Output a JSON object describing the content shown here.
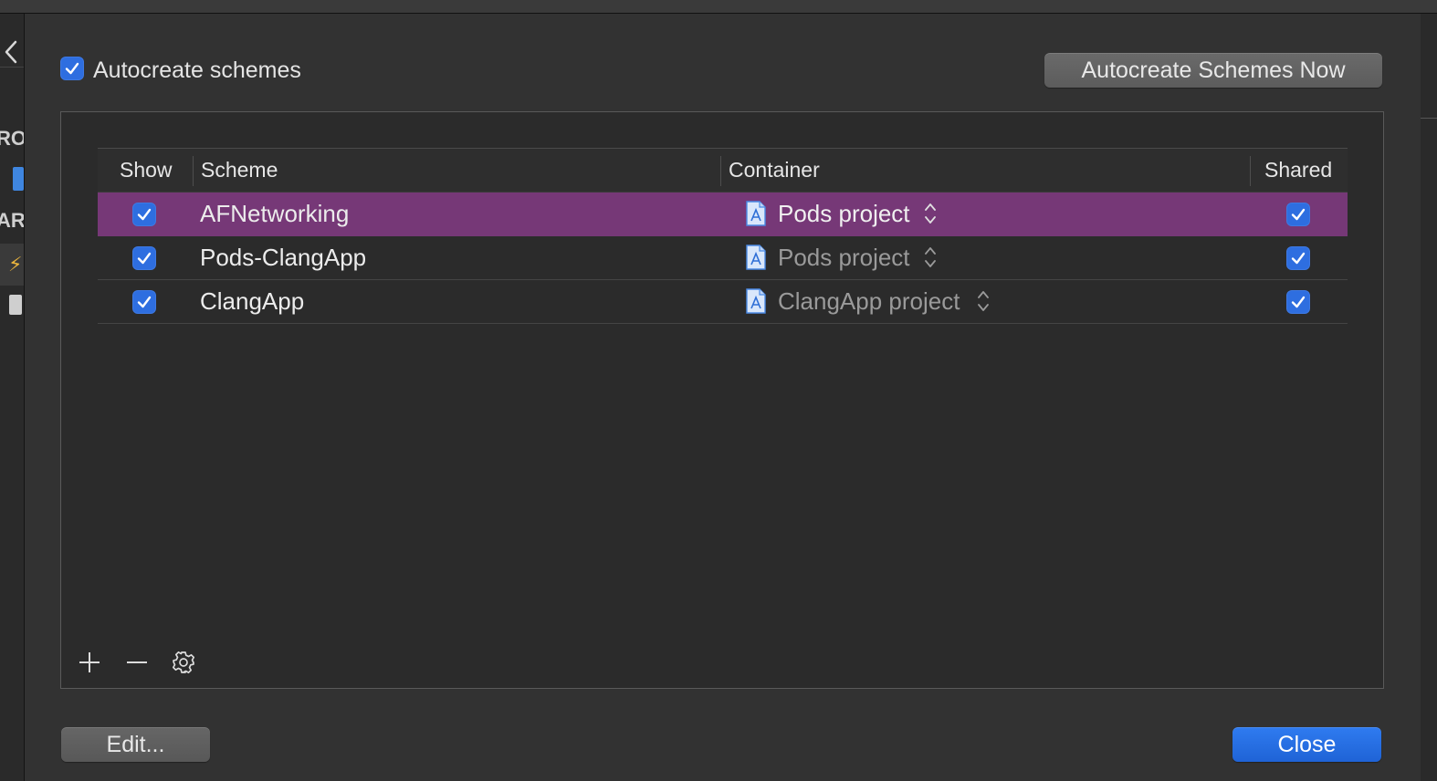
{
  "sidebar_fragments": {
    "top": "RO:",
    "middle": "ARC"
  },
  "autocreate": {
    "checkbox_checked": true,
    "label": "Autocreate schemes",
    "now_button": "Autocreate Schemes Now"
  },
  "table": {
    "columns": {
      "show": "Show",
      "scheme": "Scheme",
      "container": "Container",
      "shared": "Shared"
    },
    "rows": [
      {
        "show": true,
        "scheme": "AFNetworking",
        "container": "Pods project",
        "shared": true,
        "selected": true
      },
      {
        "show": true,
        "scheme": "Pods-ClangApp",
        "container": "Pods project",
        "shared": true,
        "selected": false
      },
      {
        "show": true,
        "scheme": "ClangApp",
        "container": "ClangApp project",
        "shared": true,
        "selected": false
      }
    ]
  },
  "toolbar": {
    "add_icon": "plus-icon",
    "remove_icon": "minus-icon",
    "settings_icon": "gear-icon"
  },
  "footer": {
    "edit_button": "Edit...",
    "close_button": "Close"
  },
  "colors": {
    "sheet_background": "#323232",
    "selection": "#763877",
    "checkbox_accent": "#2e6ee0",
    "primary_button": "#1f63d6"
  }
}
